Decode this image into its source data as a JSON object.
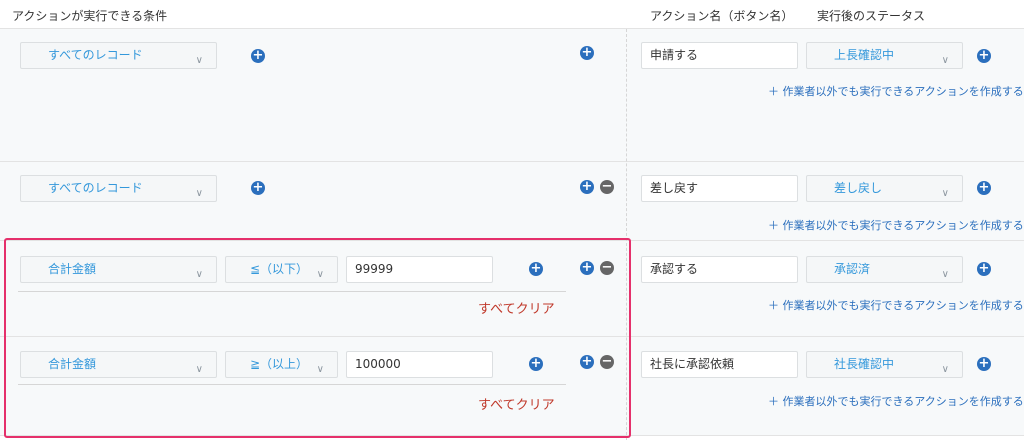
{
  "header": {
    "conditions": "アクションが実行できる条件",
    "action_name": "アクション名（ボタン名）",
    "post_status": "実行後のステータス"
  },
  "add_action_link": "＋ 作業者以外でも実行できるアクションを作成する",
  "clear_label": "すべてクリア",
  "colors": {
    "accent": "#3498db",
    "highlight": "#e5306b",
    "clear": "#c0392b"
  },
  "rows": [
    {
      "condition": "すべてのレコード",
      "action": "申請する",
      "status": "上長確認中"
    },
    {
      "condition": "すべてのレコード",
      "action": "差し戻す",
      "status": "差し戻し"
    },
    {
      "condition": "合計金額",
      "operator": "≦（以下）",
      "value": "99999",
      "action": "承認する",
      "status": "承認済"
    },
    {
      "condition": "合計金額",
      "operator": "≧（以上）",
      "value": "100000",
      "action": "社長に承認依頼",
      "status": "社長確認中"
    }
  ]
}
